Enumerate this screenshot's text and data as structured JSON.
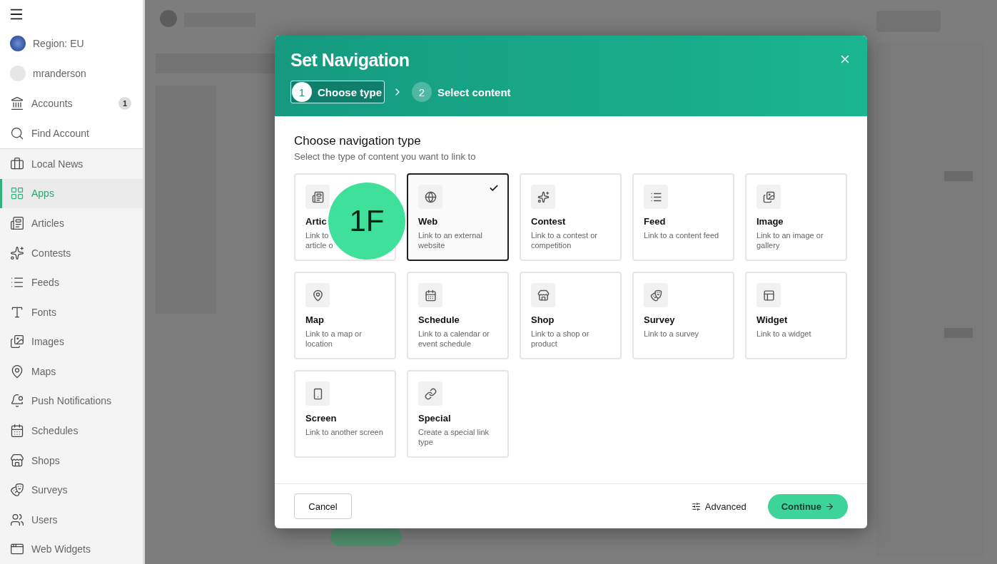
{
  "sidebar": {
    "items": [
      {
        "label": "Region: EU",
        "selected": false
      },
      {
        "label": "mranderson",
        "selected": false
      },
      {
        "label": "Accounts",
        "selected": false,
        "badge": "1"
      },
      {
        "label": "Find Account",
        "selected": false
      },
      {
        "label": "Local News",
        "selected": false
      },
      {
        "label": "Apps",
        "selected": true
      },
      {
        "label": "Articles",
        "selected": false
      },
      {
        "label": "Contests",
        "selected": false
      },
      {
        "label": "Feeds",
        "selected": false
      },
      {
        "label": "Fonts",
        "selected": false
      },
      {
        "label": "Images",
        "selected": false
      },
      {
        "label": "Maps",
        "selected": false
      },
      {
        "label": "Push Notifications",
        "selected": false
      },
      {
        "label": "Schedules",
        "selected": false
      },
      {
        "label": "Shops",
        "selected": false
      },
      {
        "label": "Surveys",
        "selected": false
      },
      {
        "label": "Users",
        "selected": false
      },
      {
        "label": "Web Widgets",
        "selected": false
      }
    ]
  },
  "dialog": {
    "title": "Set Navigation",
    "steps": [
      {
        "number": "1",
        "label": "Choose type",
        "selected": true
      },
      {
        "number": "2",
        "label": "Select content",
        "selected": false
      }
    ],
    "heading": "Choose navigation type",
    "subheading": "Select the type of content you want to link to",
    "cards": [
      {
        "title": "Artic",
        "description": "Link to\narticle o",
        "selected": false
      },
      {
        "title": "Web",
        "description": "Link to an external website",
        "selected": true
      },
      {
        "title": "Contest",
        "description": "Link to a contest or competition",
        "selected": false
      },
      {
        "title": "Feed",
        "description": "Link to a content feed",
        "selected": false
      },
      {
        "title": "Image",
        "description": "Link to an image or gallery",
        "selected": false
      },
      {
        "title": "Map",
        "description": "Link to a map or location",
        "selected": false
      },
      {
        "title": "Schedule",
        "description": "Link to a calendar or event schedule",
        "selected": false
      },
      {
        "title": "Shop",
        "description": "Link to a shop or product",
        "selected": false
      },
      {
        "title": "Survey",
        "description": "Link to a survey",
        "selected": false
      },
      {
        "title": "Widget",
        "description": "Link to a widget",
        "selected": false
      },
      {
        "title": "Screen",
        "description": "Link to another screen",
        "selected": false
      },
      {
        "title": "Special",
        "description": "Create a special link type",
        "selected": false
      }
    ],
    "cancel": "Cancel",
    "advanced": "Advanced",
    "continue": "Continue"
  },
  "annotation": "1F"
}
